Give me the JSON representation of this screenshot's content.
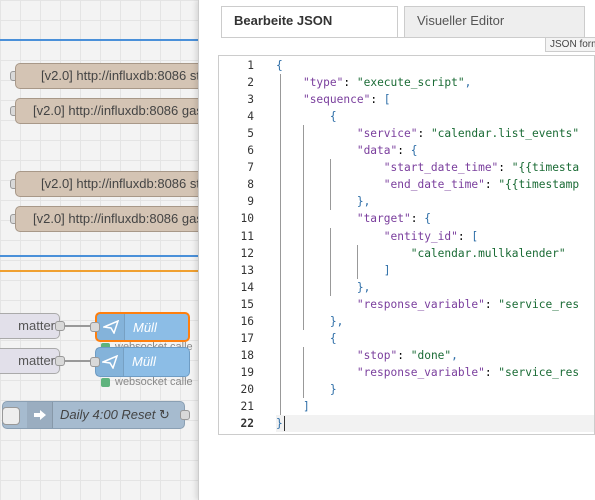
{
  "canvas": {
    "influx_nodes": [
      {
        "label": "[v2.0] http://influxdb:8086 st"
      },
      {
        "label": "[v2.0] http://influxdb:8086 gas"
      },
      {
        "label": "[v2.0] http://influxdb:8086 st"
      },
      {
        "label": "[v2.0] http://influxdb:8086 gas"
      }
    ],
    "formatter_nodes": [
      {
        "label": "matter"
      },
      {
        "label": "matter"
      }
    ],
    "muell_nodes": [
      {
        "label": "Müll",
        "status": "websocket calle"
      },
      {
        "label": "Müll",
        "status": "websocket calle"
      }
    ],
    "inject_node": {
      "label": "Daily 4:00 Reset ↻"
    },
    "colors": {
      "flow_tab_blue": "#4a90d9",
      "flow_tab_orange": "#f0a030",
      "selection": "#ff7f0e"
    }
  },
  "panel": {
    "tabs": [
      {
        "label": "Bearbeite JSON",
        "active": true
      },
      {
        "label": "Visueller Editor",
        "active": false
      }
    ],
    "tooltip": "JSON form",
    "editor": {
      "line_numbers": [
        "1",
        "2",
        "3",
        "4",
        "5",
        "6",
        "7",
        "8",
        "9",
        "10",
        "11",
        "12",
        "13",
        "14",
        "15",
        "16",
        "17",
        "18",
        "19",
        "20",
        "21",
        "22"
      ],
      "current_line": 22,
      "lines": [
        "{",
        "    \"type\": \"execute_script\",",
        "    \"sequence\": [",
        "        {",
        "            \"service\": \"calendar.list_events\"",
        "            \"data\": {",
        "                \"start_date_time\": \"{{timesta",
        "                \"end_date_time\": \"{{timestamp",
        "            },",
        "            \"target\": {",
        "                \"entity_id\": [",
        "                    \"calendar.mullkalender\"",
        "                ]",
        "            },",
        "            \"response_variable\": \"service_res",
        "        },",
        "        {",
        "            \"stop\": \"done\",",
        "            \"response_variable\": \"service_res",
        "        }",
        "    ]",
        "}"
      ]
    }
  }
}
